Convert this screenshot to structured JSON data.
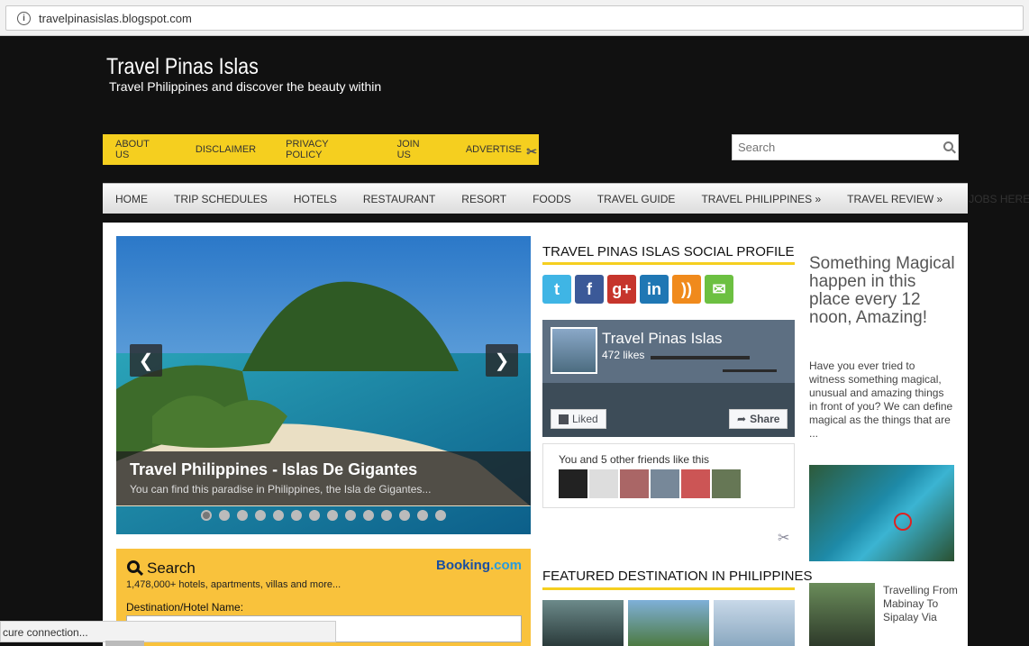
{
  "browser": {
    "url": "travelpinasislas.blogspot.com",
    "status": "cure connection..."
  },
  "site": {
    "title": "Travel Pinas Islas",
    "tagline": "Travel Philippines and discover the beauty within"
  },
  "top_nav": [
    "ABOUT US",
    "DISCLAIMER",
    "PRIVACY POLICY",
    "JOIN US",
    "ADVERTISE"
  ],
  "search": {
    "placeholder": "Search"
  },
  "main_nav": [
    "HOME",
    "TRIP SCHEDULES",
    "HOTELS",
    "RESTAURANT",
    "RESORT",
    "FOODS",
    "TRAVEL GUIDE",
    "TRAVEL PHILIPPINES »",
    "TRAVEL REVIEW »",
    "JOBS HERE »"
  ],
  "slider": {
    "title_a": "Travel Philippines",
    "title_b": " - Islas De Gigantes",
    "subtitle": "You can find this paradise in Philippines, the Isla de Gigantes...",
    "dot_count": 14,
    "active_dot": 1
  },
  "booking": {
    "title": "Search",
    "logo_a": "Booking",
    "logo_b": ".com",
    "subtitle": "1,478,000+ hotels, apartments, villas and more...",
    "dest_label": "Destination/Hotel Name:"
  },
  "social": {
    "heading": "TRAVEL PINAS ISLAS SOCIAL PROFILE",
    "icons": [
      {
        "name": "twitter-icon",
        "glyph": "t",
        "color": "#3fb5e5"
      },
      {
        "name": "facebook-icon",
        "glyph": "f",
        "color": "#3b5998"
      },
      {
        "name": "google-plus-icon",
        "glyph": "g+",
        "color": "#c6352c"
      },
      {
        "name": "linkedin-icon",
        "glyph": "in",
        "color": "#1f77b4"
      },
      {
        "name": "rss-icon",
        "glyph": "))",
        "color": "#f08a1c"
      },
      {
        "name": "email-icon",
        "glyph": "✉",
        "color": "#6cc041"
      }
    ]
  },
  "fb": {
    "page_name": "Travel Pinas Islas",
    "likes": "472 likes",
    "liked": "Liked",
    "share": "Share",
    "friends": "You and 5 other friends like this"
  },
  "featured": {
    "heading": "FEATURED DESTINATION IN PHILIPPINES"
  },
  "sidebar": {
    "headline": "Something Magical happen in this place every 12 noon, Amazing!",
    "body": "Have you ever tried to witness something magical, unusual and amazing things in front of you? We can define magical as the things that are ...",
    "link": "Travelling From Mabinay To Sipalay Via"
  }
}
